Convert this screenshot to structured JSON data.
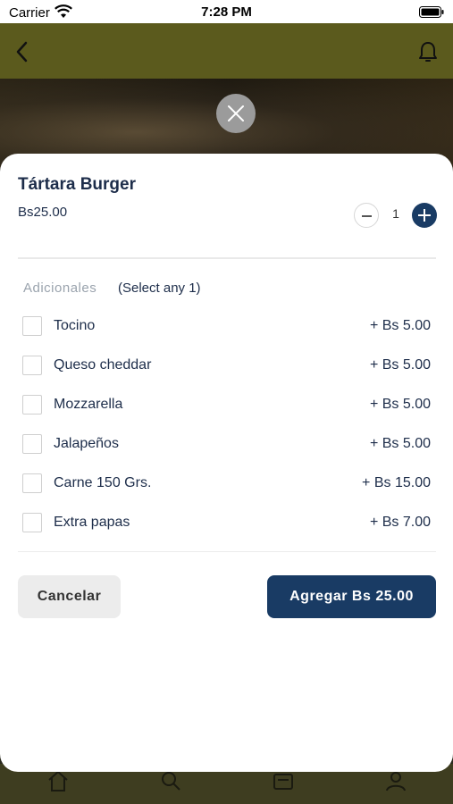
{
  "status_bar": {
    "carrier": "Carrier",
    "time": "7:28 PM"
  },
  "product": {
    "name": "Tártara Burger",
    "price": "Bs25.00",
    "quantity": "1"
  },
  "addons": {
    "title": "Adicionales",
    "hint": "(Select any 1)",
    "options": [
      {
        "label": "Tocino",
        "price": "+ Bs 5.00"
      },
      {
        "label": "Queso cheddar",
        "price": "+ Bs 5.00"
      },
      {
        "label": "Mozzarella",
        "price": "+ Bs 5.00"
      },
      {
        "label": "Jalapeños",
        "price": "+ Bs 5.00"
      },
      {
        "label": "Carne 150 Grs.",
        "price": "+ Bs 15.00"
      },
      {
        "label": "Extra papas",
        "price": "+ Bs 7.00"
      }
    ]
  },
  "actions": {
    "cancel": "Cancelar",
    "add": "Agregar Bs 25.00"
  },
  "colors": {
    "primary": "#193b64",
    "header": "#5b5a1d",
    "text": "#1d2d4a"
  },
  "icons": [
    "wifi-icon",
    "battery-icon",
    "back-icon",
    "bell-icon",
    "close-icon",
    "home-icon",
    "search-icon",
    "orders-icon",
    "profile-icon"
  ]
}
